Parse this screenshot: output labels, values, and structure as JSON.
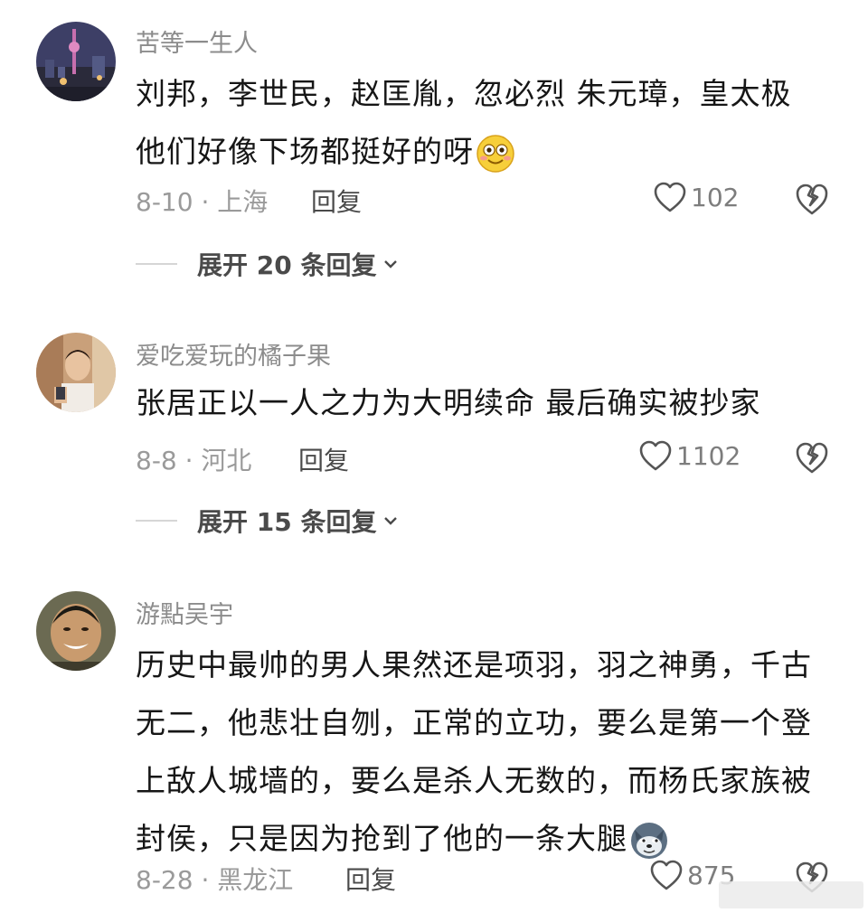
{
  "comments": [
    {
      "username": "苦等一生人",
      "text": "刘邦，李世民，赵匡胤，忽必烈  朱元璋，皇太极  他们好像下场都挺好的呀",
      "emoji": "smile-emoji",
      "date_location": "8-10 · 上海",
      "reply_label": "回复",
      "likes": "102",
      "expand_label": "展开 20 条回复"
    },
    {
      "username": "爱吃爱玩的橘子果",
      "text": "张居正以一人之力为大明续命 最后确实被抄家",
      "date_location": "8-8 · 河北",
      "reply_label": "回复",
      "likes": "1102",
      "expand_label": "展开 15 条回复"
    },
    {
      "username": "游點吴宇",
      "text": "历史中最帅的男人果然还是项羽，羽之神勇，千古无二，他悲壮自刎，正常的立功，要么是第一个登上敌人城墙的，要么是杀人无数的，而杨氏家族被封侯，只是因为抢到了他的一条大腿",
      "emoji": "doge-emoji",
      "date_location": "8-28 · 黑龙江",
      "reply_label": "回复",
      "likes": "875"
    }
  ],
  "colors": {
    "username": "#8c8c8c",
    "meta": "#9a9a9a",
    "text": "#161616"
  }
}
